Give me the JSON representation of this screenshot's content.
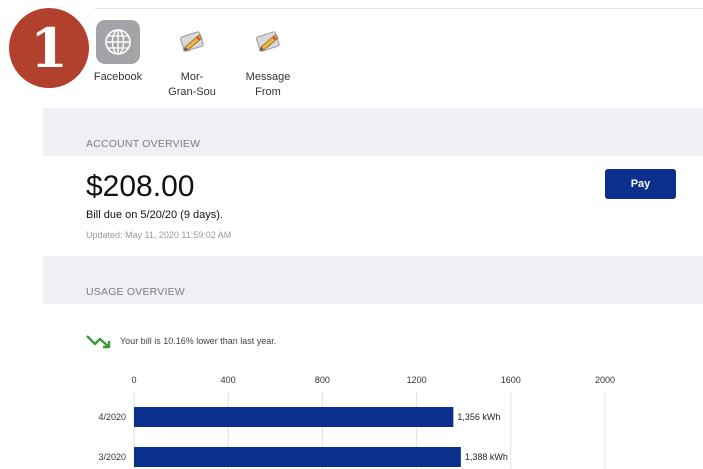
{
  "step_badge": {
    "number": "1",
    "color": "#b1412c"
  },
  "share_targets": [
    {
      "label": "Facebook",
      "icon": "globe-icon"
    },
    {
      "label": "Mor-\nGran-Sou",
      "icon": "pencil-app-icon"
    },
    {
      "label": "Message\nFrom",
      "icon": "pencil-app-icon"
    }
  ],
  "account_overview": {
    "section_title": "ACCOUNT OVERVIEW",
    "amount": "$208.00",
    "due_text": "Bill due on 5/20/20 (9 days).",
    "updated_text": "Updated: May 11, 2020 11:59:02 AM",
    "pay_label": "Pay"
  },
  "usage_overview": {
    "section_title": "USAGE OVERVIEW",
    "trend_icon": "trend-down-icon",
    "trend_text": "Your bill is 10.16% lower than last year."
  },
  "colors": {
    "brand": "#0b2f8c",
    "trend_green": "#3a9a3a",
    "band": "#efeff4"
  },
  "chart_data": {
    "type": "bar",
    "orientation": "horizontal",
    "categories": [
      "4/2020",
      "3/2020"
    ],
    "values": [
      1356,
      1388
    ],
    "value_labels": [
      "1,356 kWh",
      "1,388 kWh"
    ],
    "x_ticks": [
      "0",
      "400",
      "800",
      "1200",
      "1600",
      "2000"
    ],
    "xlim": [
      0,
      2000
    ],
    "grid": true,
    "bar_color": "#0b2f8c"
  }
}
